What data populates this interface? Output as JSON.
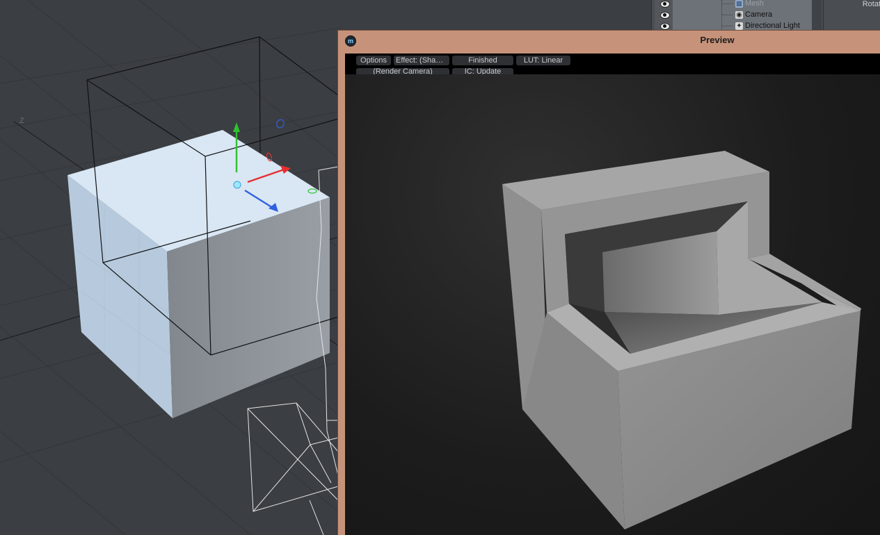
{
  "viewport": {
    "axis_label": "Z"
  },
  "item_list": {
    "items": [
      {
        "label": "Mesh",
        "icon": "mesh-icon",
        "dimmed": true
      },
      {
        "label": "Camera",
        "icon": "camera-icon",
        "dimmed": false
      },
      {
        "label": "Directional Light",
        "icon": "light-icon",
        "dimmed": false
      }
    ]
  },
  "properties": {
    "label": "Rotat"
  },
  "preview": {
    "title": "Preview",
    "toolbar": {
      "options": "Options",
      "effect": "Effect: (Shadi...",
      "status": "Finished",
      "lut": "LUT: Linear",
      "camera": "(Render Camera)",
      "ic": "IC: Update"
    }
  },
  "colors": {
    "viewport_bg": "#3b3e42",
    "preview_frame": "#c6937a",
    "axis_x": "#e53030",
    "axis_y": "#30c030",
    "axis_z": "#3060e0"
  }
}
